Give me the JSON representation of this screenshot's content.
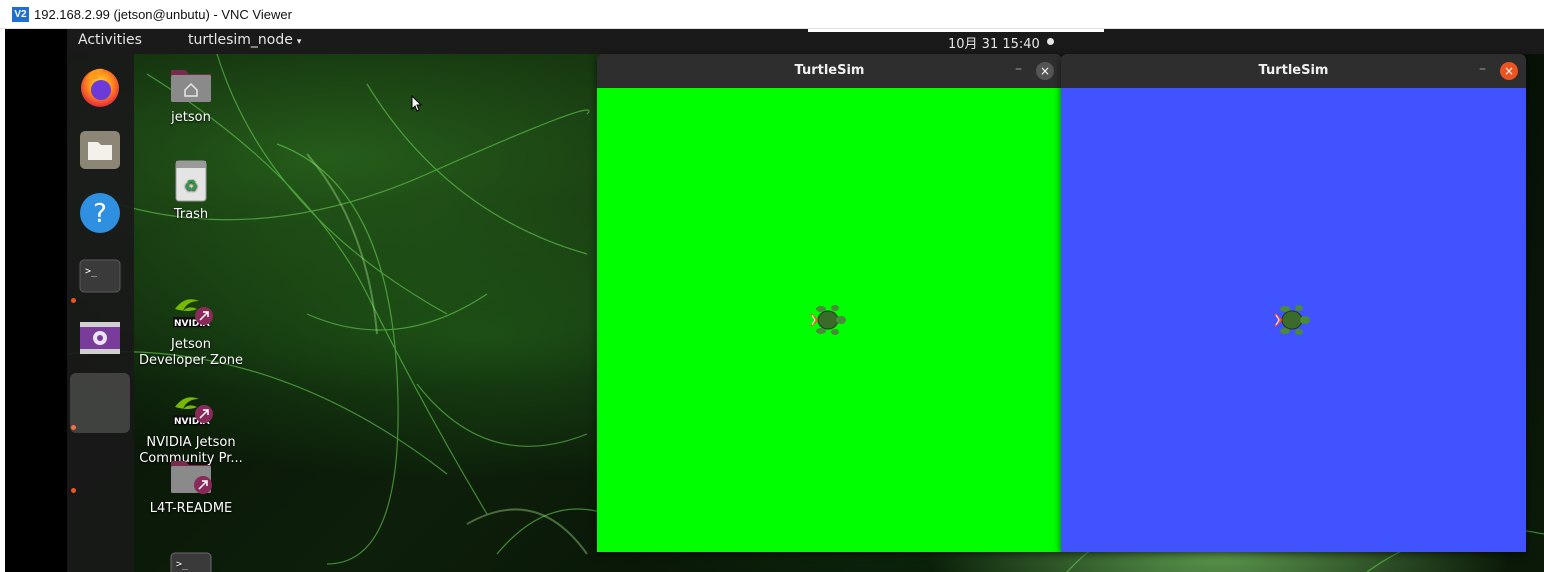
{
  "vnc": {
    "logo_text": "V2",
    "title": "192.168.2.99 (jetson@unbutu) - VNC Viewer"
  },
  "topbar": {
    "activities": "Activities",
    "app_menu": "turtlesim_node",
    "caret": "▾",
    "clock": "10月 31  15:40"
  },
  "dock": {
    "items": [
      {
        "name": "firefox-icon"
      },
      {
        "name": "files-icon"
      },
      {
        "name": "help-icon",
        "glyph": "?"
      },
      {
        "name": "terminal-icon",
        "glyph": ">_"
      },
      {
        "name": "video-icon"
      },
      {
        "name": "active-app-slot"
      }
    ]
  },
  "desktop_icons": [
    {
      "name": "jetson-folder-icon",
      "label": "jetson"
    },
    {
      "name": "trash-icon",
      "label": "Trash"
    },
    {
      "name": "jetson-developer-zone-icon",
      "label": "Jetson\nDeveloper Zone",
      "brand": "NVIDIA"
    },
    {
      "name": "nvidia-jetson-community-icon",
      "label": "NVIDIA Jetson\nCommunity Pr...",
      "brand": "NVIDIA"
    },
    {
      "name": "l4t-readme-icon",
      "label": "L4T-README"
    },
    {
      "name": "terminal-shortcut-icon",
      "glyph": ">_"
    }
  ],
  "windows": [
    {
      "title": "TurtleSim",
      "min": "–",
      "close": "×",
      "bg": "#00ff00",
      "close_color": "#555555"
    },
    {
      "title": "TurtleSim",
      "min": "–",
      "close": "×",
      "bg": "#4153ff",
      "close_color": "#e95420"
    }
  ],
  "colors": {
    "accent": "#e95420",
    "green_canvas": "#00ff00",
    "blue_canvas": "#4153ff"
  }
}
